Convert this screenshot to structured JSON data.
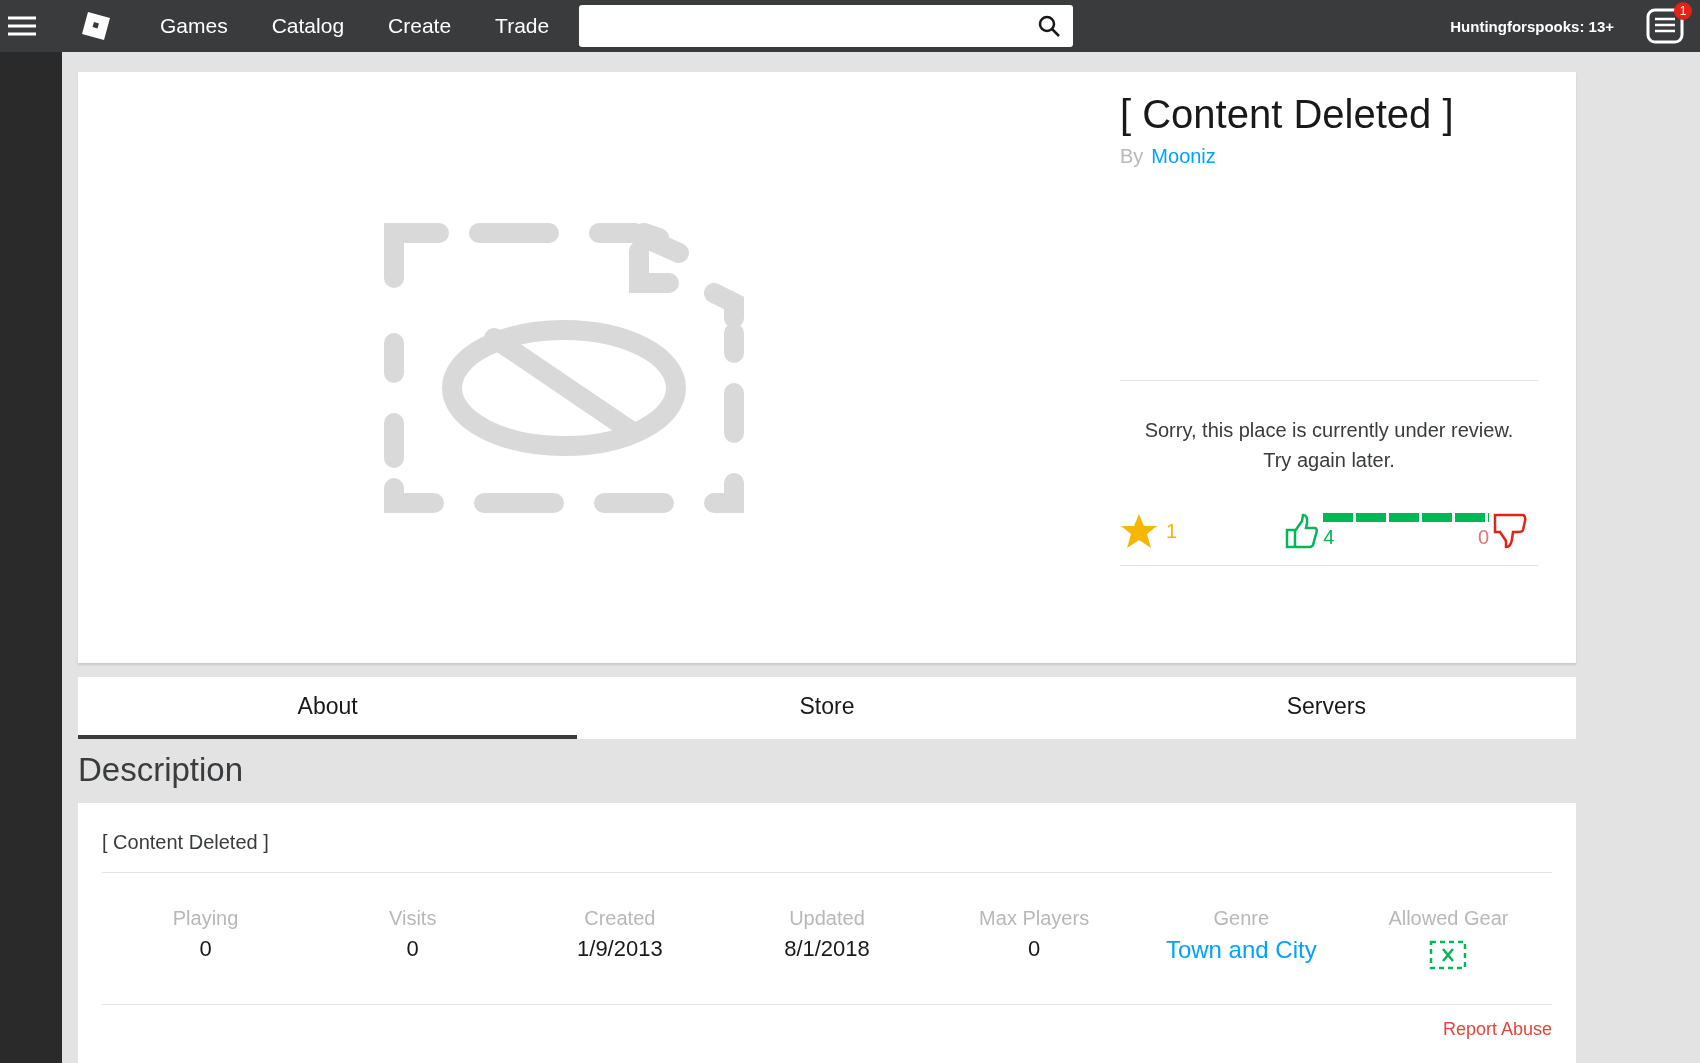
{
  "top_bar": {
    "nav": [
      "Games",
      "Catalog",
      "Create",
      "Trade"
    ],
    "username": "Huntingforspooks: 13+",
    "notification_count": "1"
  },
  "game": {
    "title": "[ Content Deleted ]",
    "by_label": "By",
    "creator": "Mooniz",
    "review_lines": [
      "Sorry, this place is currently under review.",
      "Try again later."
    ],
    "favorites": "1",
    "upvotes": "4",
    "downvotes": "0",
    "vote": {
      "level": 1
    }
  },
  "tabs": [
    {
      "label": "About",
      "selected": true
    },
    {
      "label": "Store",
      "selected": false
    },
    {
      "label": "Servers",
      "selected": false
    }
  ],
  "description": {
    "heading": "Description",
    "text": "[ Content Deleted ]"
  },
  "stats": [
    {
      "label": "Playing",
      "value": "0",
      "kind": "text"
    },
    {
      "label": "Visits",
      "value": "0",
      "kind": "text"
    },
    {
      "label": "Created",
      "value": "1/9/2013",
      "kind": "text"
    },
    {
      "label": "Updated",
      "value": "8/1/2018",
      "kind": "text"
    },
    {
      "label": "Max Players",
      "value": "0",
      "kind": "text"
    },
    {
      "label": "Genre",
      "value": "Town and City",
      "kind": "link"
    },
    {
      "label": "Allowed Gear",
      "kind": "icon"
    }
  ],
  "report_link": "Report Abuse"
}
